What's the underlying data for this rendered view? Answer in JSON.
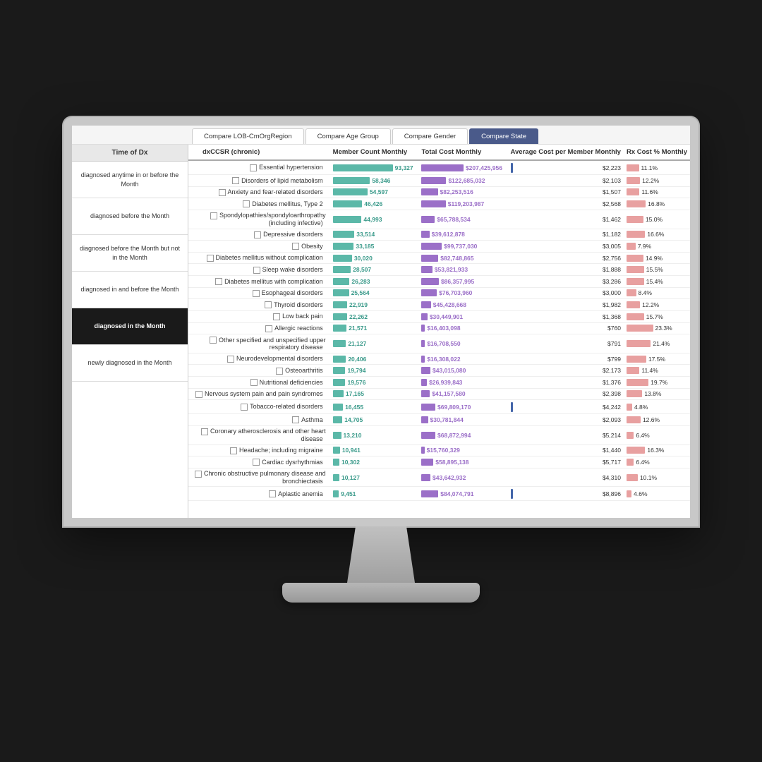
{
  "tabs": [
    {
      "label": "Compare LOB-CmOrgRegion",
      "active": false
    },
    {
      "label": "Compare Age Group",
      "active": false
    },
    {
      "label": "Compare Gender",
      "active": false
    },
    {
      "label": "Compare State",
      "active": true
    }
  ],
  "sidebar": {
    "title": "Time of Dx",
    "items": [
      {
        "label": "diagnosed anytime in or before the Month",
        "active": false
      },
      {
        "label": "diagnosed before the Month",
        "active": false
      },
      {
        "label": "diagnosed before the Month but not in the Month",
        "active": false
      },
      {
        "label": "diagnosed in and before the Month",
        "active": false
      },
      {
        "label": "diagnosed in the Month",
        "active": true
      },
      {
        "label": "newly diagnosed in the Month",
        "active": false
      }
    ]
  },
  "table": {
    "headers": [
      "dxCCSR (chronic)",
      "Member Count Monthly",
      "Total Cost Monthly",
      "Average Cost per Member Monthly",
      "Rx Cost % Monthly"
    ],
    "rows": [
      {
        "name": "Essential hypertension",
        "member": 93327,
        "total": "$207,425,956",
        "avg": "$2,223",
        "rx": "11.1%",
        "memberBar": 100,
        "totalBar": 85,
        "avgLine": true,
        "rxBar": 22
      },
      {
        "name": "Disorders of lipid metabolism",
        "member": 58346,
        "total": "$122,685,032",
        "avg": "$2,103",
        "rx": "12.2%",
        "memberBar": 62,
        "totalBar": 50,
        "avgLine": false,
        "rxBar": 24
      },
      {
        "name": "Anxiety and fear-related disorders",
        "member": 54597,
        "total": "$82,253,516",
        "avg": "$1,507",
        "rx": "11.6%",
        "memberBar": 58,
        "totalBar": 33,
        "avgLine": false,
        "rxBar": 23
      },
      {
        "name": "Diabetes mellitus, Type 2",
        "member": 46426,
        "total": "$119,203,987",
        "avg": "$2,568",
        "rx": "16.8%",
        "memberBar": 49,
        "totalBar": 49,
        "avgLine": false,
        "rxBar": 34
      },
      {
        "name": "Spondylopathies/spondyloarthropathy (including infective)",
        "member": 44993,
        "total": "$65,788,534",
        "avg": "$1,462",
        "rx": "15.0%",
        "memberBar": 48,
        "totalBar": 27,
        "avgLine": false,
        "rxBar": 30
      },
      {
        "name": "Depressive disorders",
        "member": 33514,
        "total": "$39,612,878",
        "avg": "$1,182",
        "rx": "16.6%",
        "memberBar": 36,
        "totalBar": 16,
        "avgLine": false,
        "rxBar": 33
      },
      {
        "name": "Obesity",
        "member": 33185,
        "total": "$99,737,030",
        "avg": "$3,005",
        "rx": "7.9%",
        "memberBar": 35,
        "totalBar": 41,
        "avgLine": false,
        "rxBar": 16
      },
      {
        "name": "Diabetes mellitus without complication",
        "member": 30020,
        "total": "$82,748,865",
        "avg": "$2,756",
        "rx": "14.9%",
        "memberBar": 32,
        "totalBar": 34,
        "avgLine": false,
        "rxBar": 30
      },
      {
        "name": "Sleep wake disorders",
        "member": 28507,
        "total": "$53,821,933",
        "avg": "$1,888",
        "rx": "15.5%",
        "memberBar": 30,
        "totalBar": 22,
        "avgLine": false,
        "rxBar": 31
      },
      {
        "name": "Diabetes mellitus with complication",
        "member": 26283,
        "total": "$86,357,995",
        "avg": "$3,286",
        "rx": "15.4%",
        "memberBar": 28,
        "totalBar": 35,
        "avgLine": false,
        "rxBar": 31
      },
      {
        "name": "Esophageal disorders",
        "member": 25564,
        "total": "$76,703,960",
        "avg": "$3,000",
        "rx": "8.4%",
        "memberBar": 27,
        "totalBar": 31,
        "avgLine": false,
        "rxBar": 17
      },
      {
        "name": "Thyroid disorders",
        "member": 22919,
        "total": "$45,428,668",
        "avg": "$1,982",
        "rx": "12.2%",
        "memberBar": 24,
        "totalBar": 19,
        "avgLine": false,
        "rxBar": 24
      },
      {
        "name": "Low back pain",
        "member": 22262,
        "total": "$30,449,901",
        "avg": "$1,368",
        "rx": "15.7%",
        "memberBar": 24,
        "totalBar": 12,
        "avgLine": false,
        "rxBar": 31
      },
      {
        "name": "Allergic reactions",
        "member": 21571,
        "total": "$16,403,098",
        "avg": "$760",
        "rx": "23.3%",
        "memberBar": 23,
        "totalBar": 7,
        "avgLine": false,
        "rxBar": 47
      },
      {
        "name": "Other specified and unspecified upper respiratory disease",
        "member": 21127,
        "total": "$16,708,550",
        "avg": "$791",
        "rx": "21.4%",
        "memberBar": 22,
        "totalBar": 7,
        "avgLine": false,
        "rxBar": 43
      },
      {
        "name": "Neurodevelopmental disorders",
        "member": 20406,
        "total": "$16,308,022",
        "avg": "$799",
        "rx": "17.5%",
        "memberBar": 22,
        "totalBar": 7,
        "avgLine": false,
        "rxBar": 35
      },
      {
        "name": "Osteoarthritis",
        "member": 19794,
        "total": "$43,015,080",
        "avg": "$2,173",
        "rx": "11.4%",
        "memberBar": 21,
        "totalBar": 18,
        "avgLine": false,
        "rxBar": 23
      },
      {
        "name": "Nutritional deficiencies",
        "member": 19576,
        "total": "$26,939,843",
        "avg": "$1,376",
        "rx": "19.7%",
        "memberBar": 21,
        "totalBar": 11,
        "avgLine": false,
        "rxBar": 39
      },
      {
        "name": "Nervous system pain and pain syndromes",
        "member": 17165,
        "total": "$41,157,580",
        "avg": "$2,398",
        "rx": "13.8%",
        "memberBar": 18,
        "totalBar": 17,
        "avgLine": false,
        "rxBar": 28
      },
      {
        "name": "Tobacco-related disorders",
        "member": 16455,
        "total": "$69,809,170",
        "avg": "$4,242",
        "rx": "4.8%",
        "memberBar": 17,
        "totalBar": 28,
        "avgLine": true,
        "rxBar": 10
      },
      {
        "name": "Asthma",
        "member": 14705,
        "total": "$30,781,844",
        "avg": "$2,093",
        "rx": "12.6%",
        "memberBar": 16,
        "totalBar": 13,
        "avgLine": false,
        "rxBar": 25
      },
      {
        "name": "Coronary atherosclerosis and other heart disease",
        "member": 13210,
        "total": "$68,872,994",
        "avg": "$5,214",
        "rx": "6.4%",
        "memberBar": 14,
        "totalBar": 28,
        "avgLine": false,
        "rxBar": 13
      },
      {
        "name": "Headache; including migraine",
        "member": 10941,
        "total": "$15,760,329",
        "avg": "$1,440",
        "rx": "16.3%",
        "memberBar": 12,
        "totalBar": 6,
        "avgLine": false,
        "rxBar": 33
      },
      {
        "name": "Cardiac dysrhythmias",
        "member": 10302,
        "total": "$58,895,138",
        "avg": "$5,717",
        "rx": "6.4%",
        "memberBar": 11,
        "totalBar": 24,
        "avgLine": false,
        "rxBar": 13
      },
      {
        "name": "Chronic obstructive pulmonary disease and bronchiectasis",
        "member": 10127,
        "total": "$43,642,932",
        "avg": "$4,310",
        "rx": "10.1%",
        "memberBar": 11,
        "totalBar": 18,
        "avgLine": false,
        "rxBar": 20
      },
      {
        "name": "Aplastic anemia",
        "member": 9451,
        "total": "$84,074,791",
        "avg": "$8,896",
        "rx": "4.6%",
        "memberBar": 10,
        "totalBar": 34,
        "avgLine": true,
        "rxBar": 9
      }
    ]
  }
}
